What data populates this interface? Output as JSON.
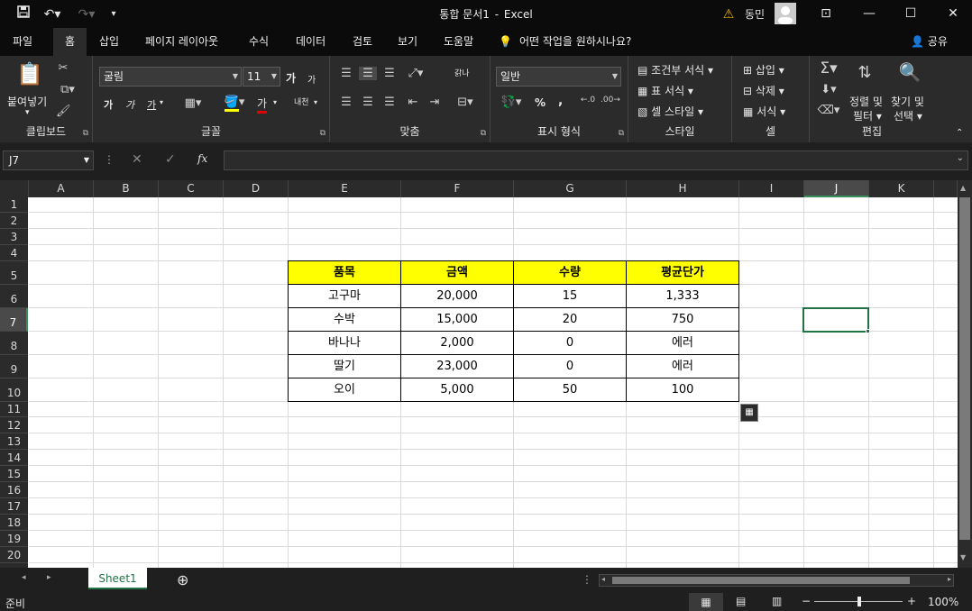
{
  "titlebar": {
    "doc_name": "통합 문서1",
    "separator": "-",
    "app_name": "Excel",
    "user_name": "동민"
  },
  "menu": {
    "tabs": [
      "파일",
      "홈",
      "삽입",
      "페이지 레이아웃",
      "수식",
      "데이터",
      "검토",
      "보기",
      "도움말"
    ],
    "active_tab": "홈",
    "tell_me": "어떤 작업을 원하시나요?",
    "share": "공유"
  },
  "ribbon": {
    "clipboard": {
      "label": "클립보드",
      "paste": "붙여넣기"
    },
    "font": {
      "label": "글꼴",
      "font_name": "굴림",
      "font_size": "11",
      "grow": "가",
      "shrink": "가",
      "bold": "가",
      "italic": "가",
      "underline": "가",
      "font_color": "가",
      "phonetic": "내천"
    },
    "alignment": {
      "label": "맞춤",
      "wrap": "갉나"
    },
    "number": {
      "label": "표시 형식",
      "format": "일반",
      "percent": "%",
      "comma": ","
    },
    "styles": {
      "label": "스타일",
      "conditional": "조건부 서식",
      "table": "표 서식",
      "cell_style": "셀 스타일"
    },
    "cells": {
      "label": "셀",
      "insert": "삽입",
      "delete": "삭제",
      "format": "서식"
    },
    "editing": {
      "label": "편집",
      "sort": "정렬 및",
      "filter": "필터",
      "find": "찾기 및",
      "select": "선택"
    }
  },
  "formula_bar": {
    "name_box": "J7",
    "fx": "fx",
    "value": ""
  },
  "grid": {
    "columns": [
      "A",
      "B",
      "C",
      "D",
      "E",
      "F",
      "G",
      "H",
      "I",
      "J",
      "K"
    ],
    "rows": [
      "1",
      "2",
      "3",
      "4",
      "5",
      "6",
      "7",
      "8",
      "9",
      "10",
      "11",
      "12",
      "13",
      "14",
      "15",
      "16",
      "17",
      "18",
      "19",
      "20"
    ],
    "selected_cell": "J7",
    "table": {
      "headers": [
        "품목",
        "금액",
        "수량",
        "평균단가"
      ],
      "rows": [
        [
          "고구마",
          "20,000",
          "15",
          "1,333"
        ],
        [
          "수박",
          "15,000",
          "20",
          "750"
        ],
        [
          "바나나",
          "2,000",
          "0",
          "에러"
        ],
        [
          "딸기",
          "23,000",
          "0",
          "에러"
        ],
        [
          "오이",
          "5,000",
          "50",
          "100"
        ]
      ],
      "header_color": "#ffff00"
    }
  },
  "sheet_tabs": {
    "active": "Sheet1"
  },
  "status": {
    "mode": "준비",
    "zoom": "100%"
  },
  "colors": {
    "accent": "#217346",
    "ribbon_bg": "#2b2b2b",
    "titlebar_bg": "#0b0b0b"
  }
}
